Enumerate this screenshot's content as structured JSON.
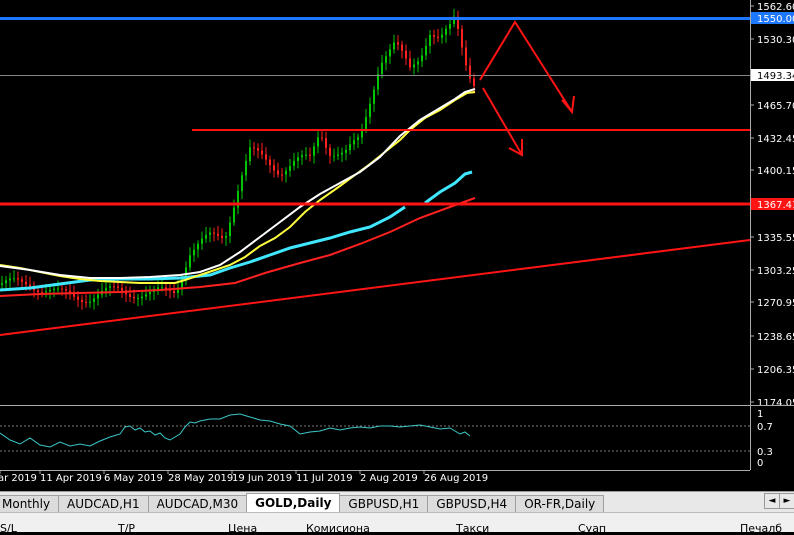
{
  "price_axis": {
    "ticks": [
      "1562.60",
      "1530.30",
      "1497.",
      "1465.70",
      "1432.45",
      "1400.15",
      "1367.85",
      "1335.55",
      "1303.25",
      "1270.95",
      "1238.65",
      "1206.35",
      "1174.05"
    ],
    "badges": {
      "blue_line": "1550.00",
      "current": "1493.34",
      "red_line": "1367.41"
    }
  },
  "date_axis": {
    "labels": [
      "ar 2019",
      "11 Apr 2019",
      "6 May 2019",
      "28 May 2019",
      "19 Jun 2019",
      "11 Jul 2019",
      "2 Aug 2019",
      "26 Aug 2019"
    ]
  },
  "oscillator": {
    "scale_labels": [
      "1",
      "0.7",
      "0.3",
      "0"
    ]
  },
  "tabs": [
    {
      "label": "Monthly"
    },
    {
      "label": "AUDCAD,H1"
    },
    {
      "label": "AUDCAD,M30"
    },
    {
      "label": "GOLD,Daily",
      "active": true
    },
    {
      "label": "GBPUSD,H1"
    },
    {
      "label": "GBPUSD,H4"
    },
    {
      "label": "OR-FR,Daily"
    }
  ],
  "scroll_buttons": {
    "left": "◄",
    "right": "►"
  },
  "terminal_columns": [
    "S/L",
    "T/P",
    "Цена",
    "Комисиона",
    "Такси",
    "Суап",
    "Печалб"
  ],
  "colors": {
    "background": "#000000",
    "bull_candle": "#00c800",
    "bear_candle": "#ff2020",
    "blue_level": "#1e78ff",
    "red_level": "#ff1414",
    "white_ma": "#ffffff",
    "yellow_line": "#ffff40",
    "cyan_line": "#40e8ff",
    "red_ma": "#ff2020",
    "oscillator_line": "#3cc8c8"
  }
}
